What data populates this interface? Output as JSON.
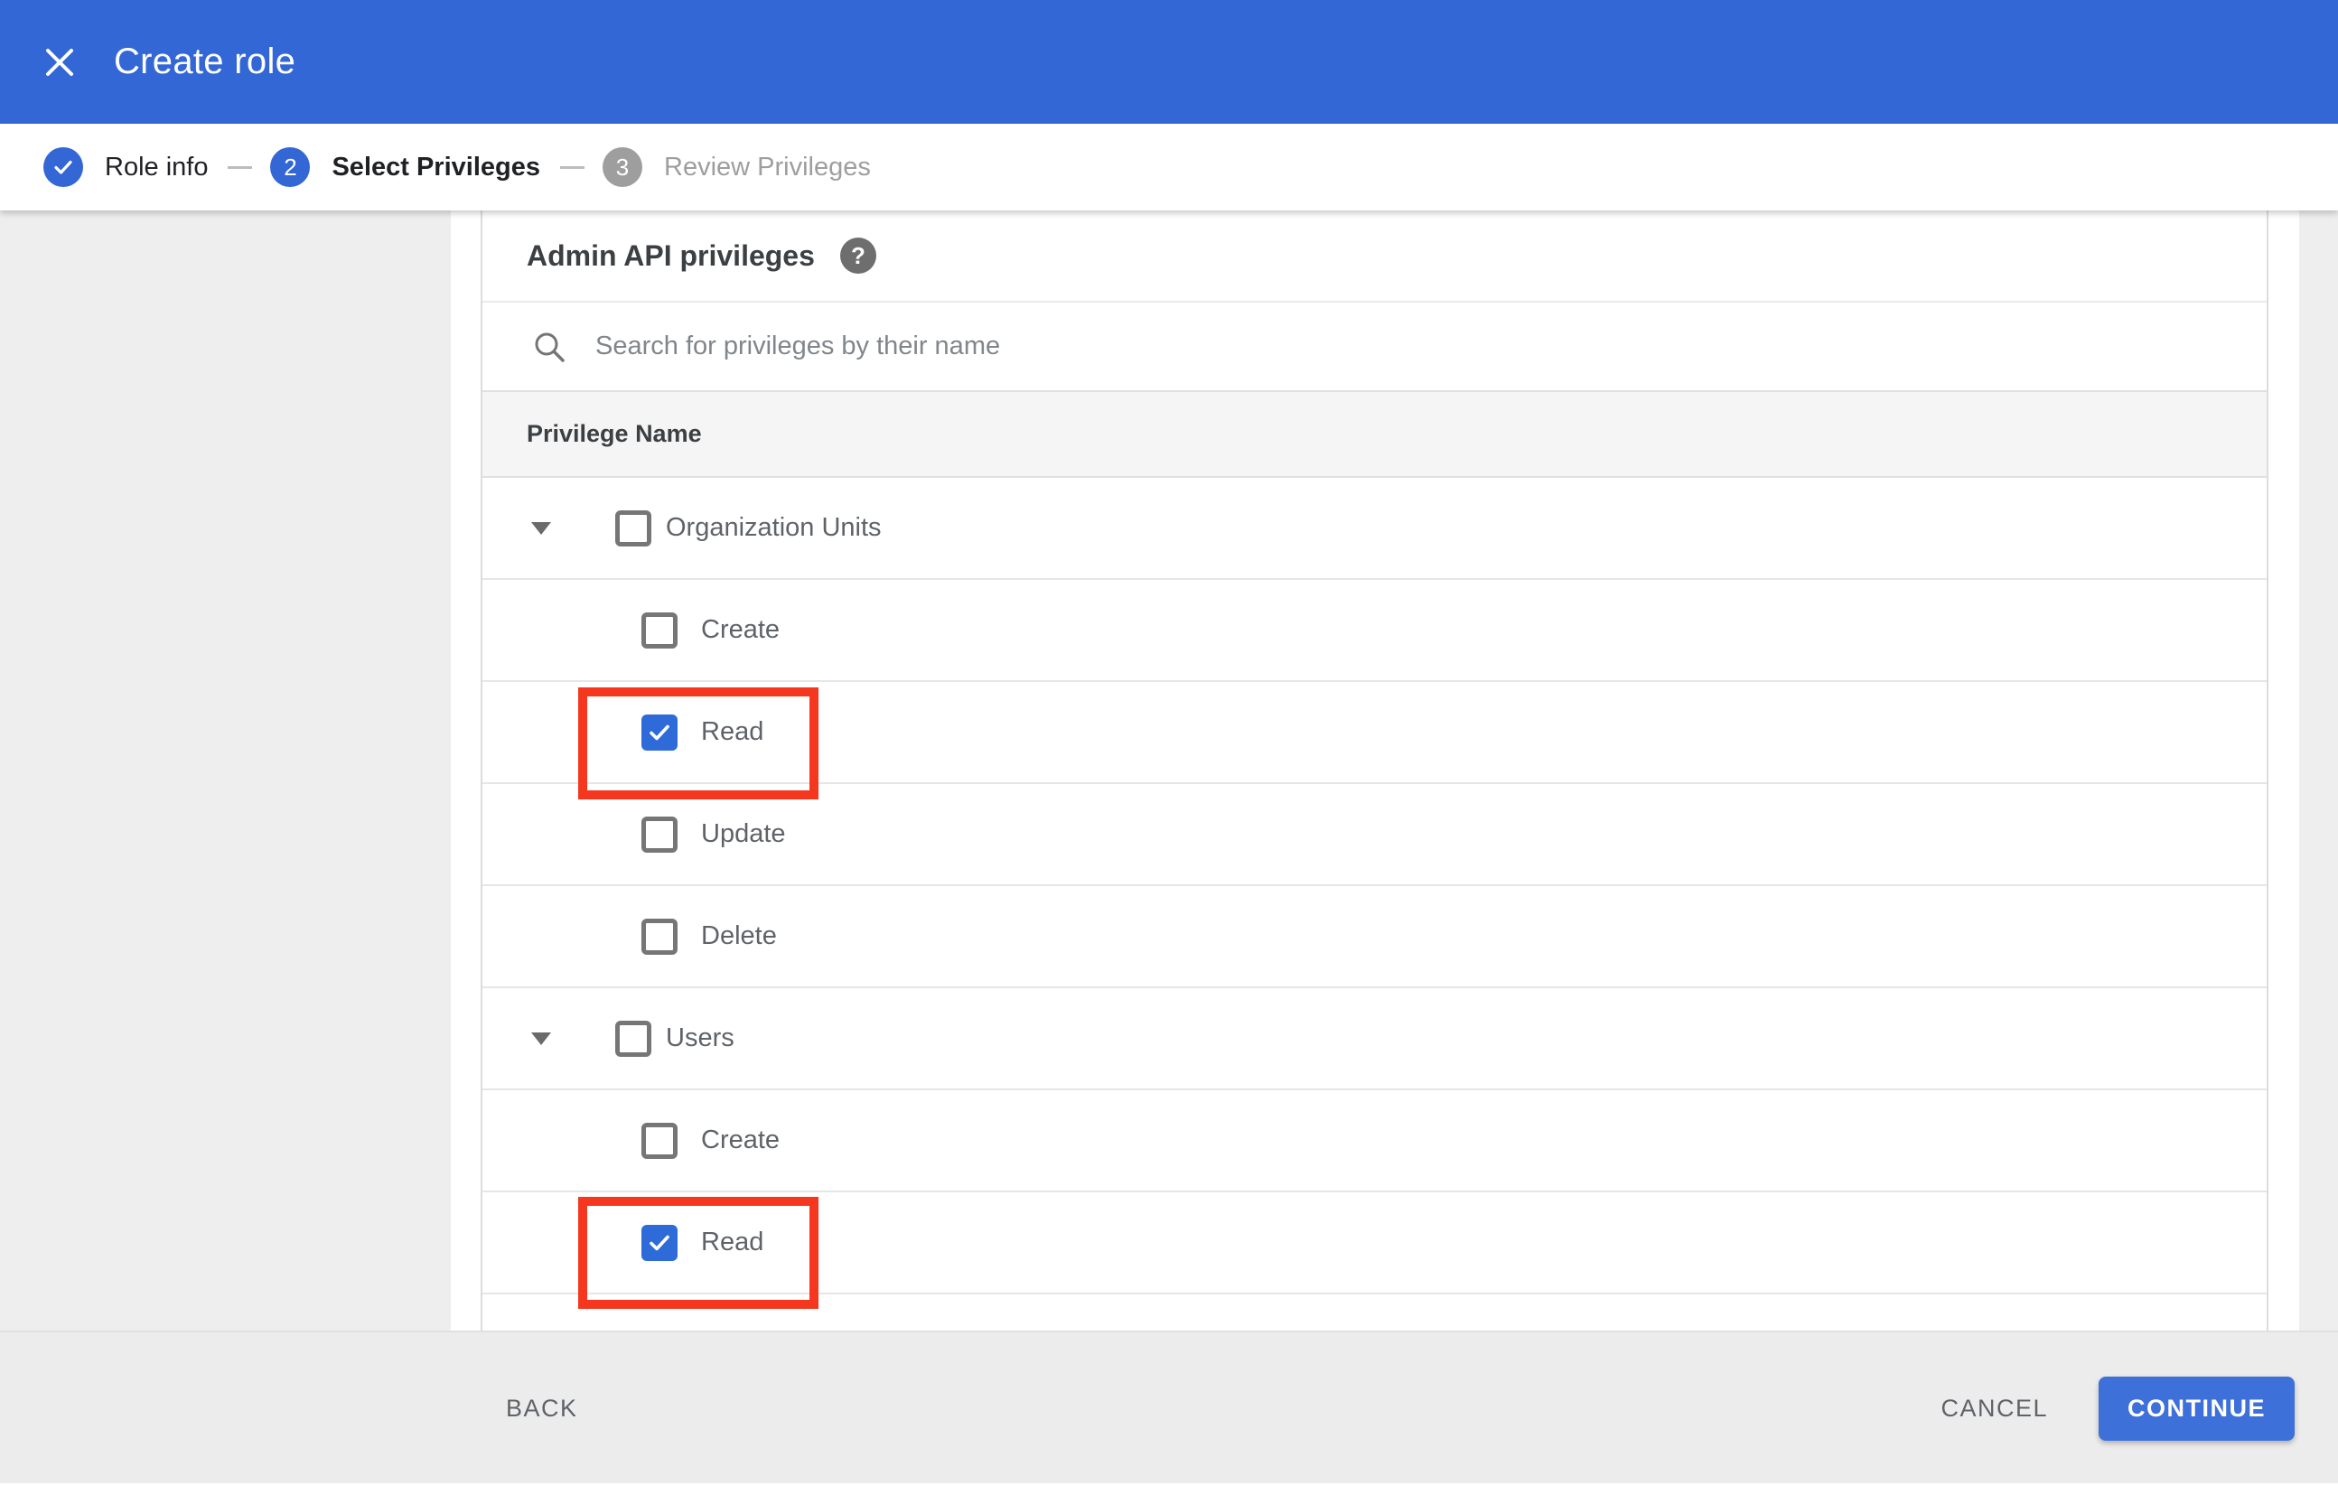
{
  "header": {
    "title": "Create role"
  },
  "stepper": {
    "steps": [
      {
        "label": "Role info",
        "number": "",
        "state": "done"
      },
      {
        "label": "Select Privileges",
        "number": "2",
        "state": "active"
      },
      {
        "label": "Review Privileges",
        "number": "3",
        "state": "upcoming"
      }
    ]
  },
  "panel": {
    "title": "Admin API privileges",
    "help_icon": "?",
    "search_placeholder": "Search for privileges by their name",
    "table": {
      "header": "Privilege Name",
      "rows": [
        {
          "type": "group",
          "label": "Organization Units",
          "checked": false,
          "highlighted": false
        },
        {
          "type": "child",
          "label": "Create",
          "checked": false,
          "highlighted": false
        },
        {
          "type": "child",
          "label": "Read",
          "checked": true,
          "highlighted": true
        },
        {
          "type": "child",
          "label": "Update",
          "checked": false,
          "highlighted": false
        },
        {
          "type": "child",
          "label": "Delete",
          "checked": false,
          "highlighted": false
        },
        {
          "type": "group",
          "label": "Users",
          "checked": false,
          "highlighted": false
        },
        {
          "type": "child",
          "label": "Create",
          "checked": false,
          "highlighted": false
        },
        {
          "type": "child",
          "label": "Read",
          "checked": true,
          "highlighted": true
        }
      ]
    }
  },
  "footer": {
    "back": "BACK",
    "cancel": "CANCEL",
    "continue": "CONTINUE"
  },
  "icons": {
    "close": "x-cross",
    "step_done": "checkmark",
    "search": "magnifier",
    "expand": "triangle-down",
    "checkbox_check": "checkmark"
  },
  "colors": {
    "appbar_blue": "#3367d6",
    "step_active_blue": "#3367d6",
    "step_upcoming_gray": "#9e9e9e",
    "checkbox_checked_blue": "#2e6bd9",
    "continue_button_blue": "#3d70d8",
    "highlight_red": "#f4371e",
    "table_header_bg": "#f5f5f5",
    "footer_bg": "#ececec",
    "side_panel_bg": "#eeeeee"
  }
}
